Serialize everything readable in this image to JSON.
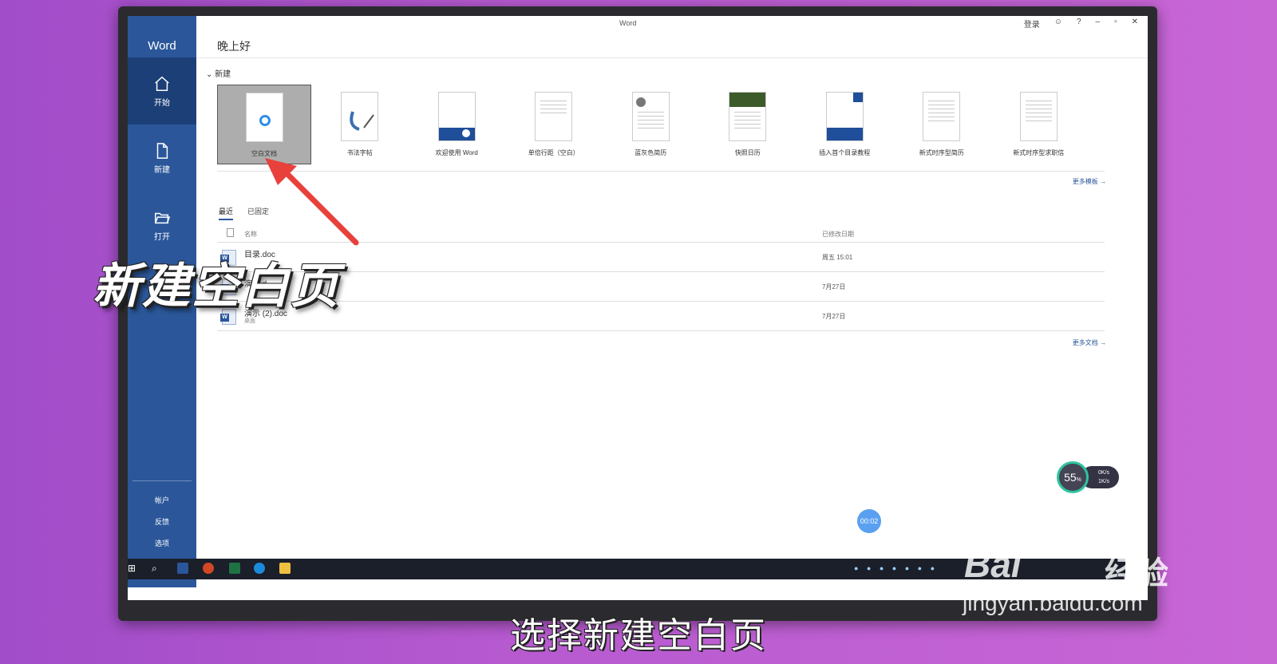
{
  "app": {
    "window_title": "Word",
    "sidebar_title": "Word"
  },
  "titlebar": {
    "login": "登录",
    "help": "?",
    "minimize": "–",
    "restore": "▫",
    "close": "✕"
  },
  "sidebar": {
    "items": [
      {
        "label": "开始",
        "icon": "home-icon"
      },
      {
        "label": "新建",
        "icon": "new-document-icon"
      },
      {
        "label": "打开",
        "icon": "open-folder-icon"
      }
    ],
    "bottom": [
      "帐户",
      "反馈",
      "选项"
    ]
  },
  "main": {
    "greeting": "晚上好",
    "new_section": "新建",
    "templates": [
      "空白文档",
      "书法字帖",
      "欢迎使用 Word",
      "单倍行距（空白）",
      "蓝灰色简历",
      "快照日历",
      "插入首个目录教程",
      "新式时序型简历",
      "新式时序型求职信"
    ],
    "more_templates": "更多模板 →",
    "tabs": [
      "最近",
      "已固定"
    ],
    "file_list": {
      "col_name": "名称",
      "col_date": "已修改日期",
      "rows": [
        {
          "name": "目录.doc",
          "location": "",
          "date": "周五 15:01"
        },
        {
          "name": "演示.d",
          "location": "",
          "date": "7月27日"
        },
        {
          "name": "演示 (2).doc",
          "location": "桌面",
          "date": "7月27日"
        }
      ]
    },
    "more_docs": "更多文档 →"
  },
  "widgets": {
    "timer": "00:02",
    "meter_value": "55",
    "meter_unit": "%",
    "net_up": "0K/s",
    "net_down": "1K/s"
  },
  "overlay": {
    "caption_big": "新建空白页",
    "subtitle": "选择新建空白页"
  },
  "watermark": {
    "logo": "Bai经验",
    "url": "jingyan.baidu.com"
  },
  "colors": {
    "word_blue": "#2b579a",
    "arrow_red": "#e8413c"
  }
}
